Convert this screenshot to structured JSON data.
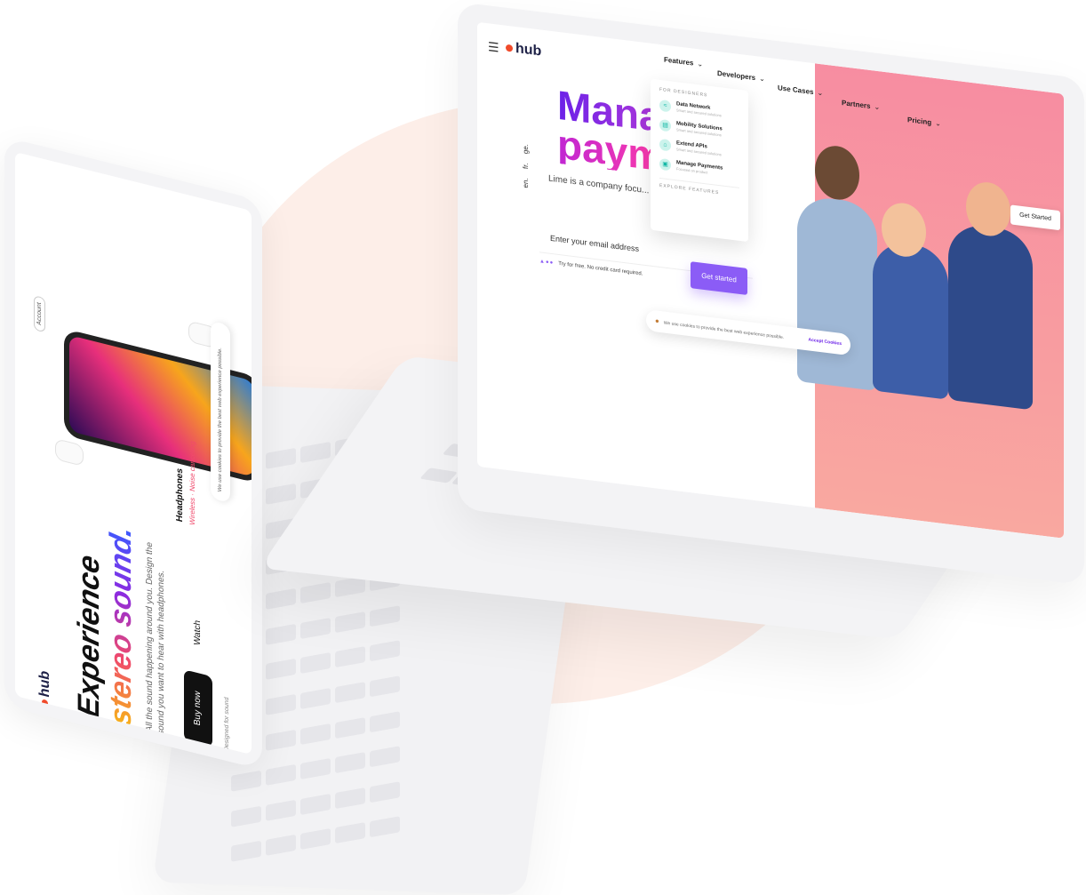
{
  "back_laptop": {
    "logo": "hub",
    "headline_line1": "Experience",
    "headline_line2": "stereo sound.",
    "subtitle": "All the sound happening around you. Design the sound you want to hear with headphones.",
    "primary_button": "Buy now",
    "secondary_button": "Watch",
    "tag": "Designed for sound",
    "product_name": "Headphones",
    "product_sub": "Wireless · Noise canceling",
    "top_pill": "Account",
    "cookie_text": "We use cookies to provide the best web experience possible."
  },
  "front_laptop": {
    "logo": "hub",
    "nav": {
      "features": "Features",
      "developers": "Developers",
      "use_cases": "Use Cases",
      "partners": "Partners",
      "pricing": "Pricing"
    },
    "dropdown": {
      "heading": "FOR DESIGNERS",
      "items": [
        {
          "title": "Data Network",
          "subtitle": "Smart and secured solutions",
          "icon": "wifi-icon"
        },
        {
          "title": "Mobility Solutions",
          "subtitle": "Smart and secured solutions",
          "icon": "mobile-icon"
        },
        {
          "title": "Extend APIs",
          "subtitle": "Smart and secured solutions",
          "icon": "home-icon"
        },
        {
          "title": "Manage Payments",
          "subtitle": "Focused on product",
          "icon": "payment-icon"
        }
      ],
      "footer": "EXPLORE FEATURES"
    },
    "headline_line1": "Mana",
    "headline_line2": "paym",
    "languages": [
      "en.",
      "fr.",
      "ge."
    ],
    "description": "Lime is a company focu... affordable and conveni...",
    "email_placeholder": "Enter your email address",
    "cta_button": "Get started",
    "try_text": "Try for free. No credit card required.",
    "top_cta": "Get Started",
    "cookie_text": "We use cookies to provide the best web experience possible.",
    "cookie_accept": "Accept Cookies"
  },
  "colors": {
    "accent": "#8b5cf6",
    "headline_start": "#6b21e8",
    "headline_end": "#ff3ca8",
    "hero_pink": "#f78da1",
    "logo_dot": "#f04a2a",
    "blob": "#fdeee8"
  }
}
